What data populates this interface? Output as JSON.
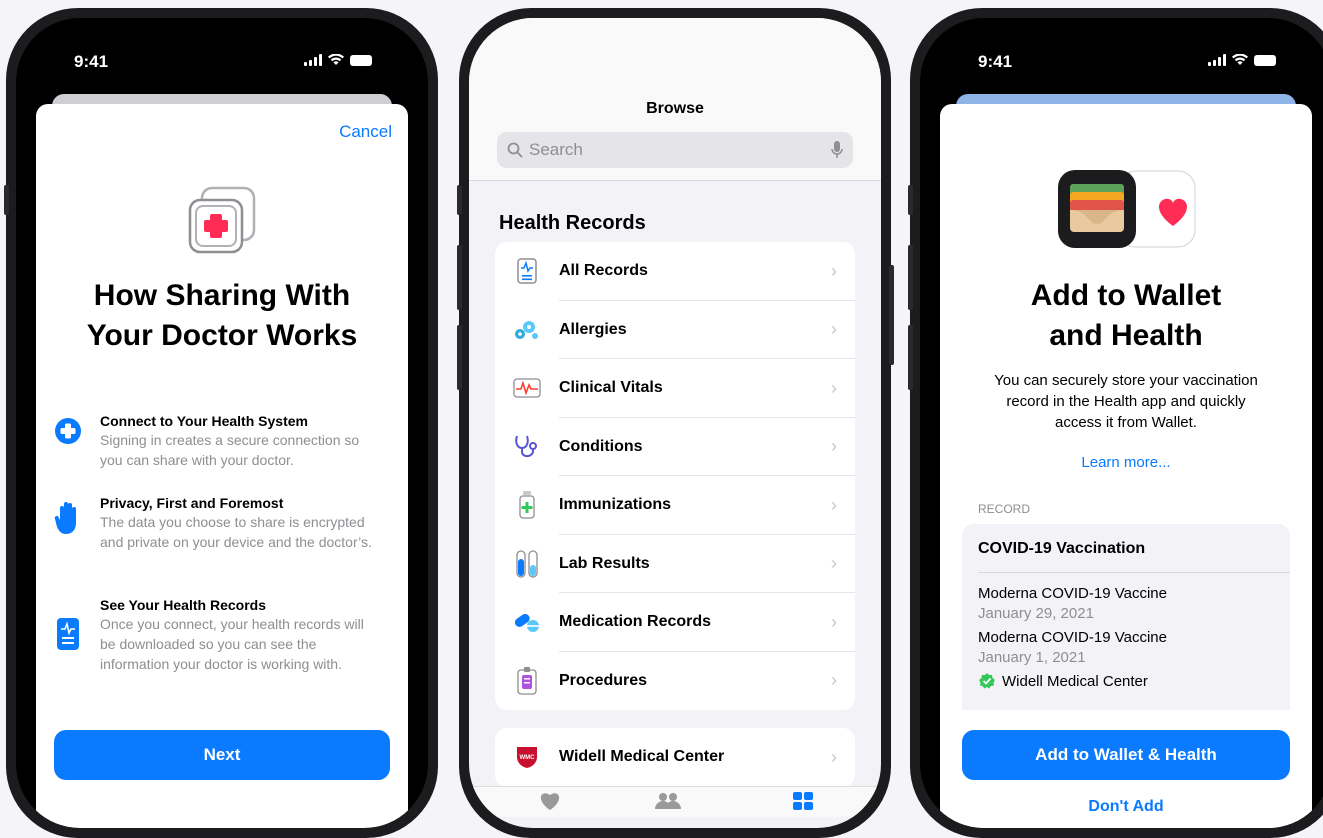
{
  "status": {
    "time": "9:41"
  },
  "left": {
    "cancel": "Cancel",
    "title_line1": "How Sharing With",
    "title_line2": "Your Doctor Works",
    "features": [
      {
        "title": "Connect to Your Health System",
        "desc": "Signing in creates a secure connection so you can share with your doctor.",
        "icon": "plus-circle-icon"
      },
      {
        "title": "Privacy, First and Foremost",
        "desc": "The data you choose to share is encrypted and private on your device and the doctor’s.",
        "icon": "hand-icon"
      },
      {
        "title": "See Your Health Records",
        "desc": "Once you connect, your health records will be downloaded so you can see the information your doctor is working with.",
        "icon": "record-icon"
      }
    ],
    "next": "Next"
  },
  "middle": {
    "nav_title": "Browse",
    "search_placeholder": "Search",
    "section": "Health Records",
    "items": [
      {
        "label": "All Records",
        "icon": "all-records-icon"
      },
      {
        "label": "Allergies",
        "icon": "allergies-icon"
      },
      {
        "label": "Clinical Vitals",
        "icon": "clinical-vitals-icon"
      },
      {
        "label": "Conditions",
        "icon": "stethoscope-icon"
      },
      {
        "label": "Immunizations",
        "icon": "vial-icon"
      },
      {
        "label": "Lab Results",
        "icon": "test-tubes-icon"
      },
      {
        "label": "Medication Records",
        "icon": "pills-icon"
      },
      {
        "label": "Procedures",
        "icon": "procedures-icon"
      }
    ],
    "provider": "Widell Medical Center",
    "provider_icon_text": "WMC"
  },
  "right": {
    "title_line1": "Add to Wallet",
    "title_line2": "and Health",
    "desc": "You can securely store your vaccination record in the Health app and quickly access it from Wallet.",
    "learn_more": "Learn more...",
    "record_label": "RECORD",
    "record_title": "COVID-19 Vaccination",
    "doses": [
      {
        "name": "Moderna COVID-19 Vaccine",
        "date": "January 29, 2021"
      },
      {
        "name": "Moderna COVID-19 Vaccine",
        "date": "January 1, 2021"
      }
    ],
    "issuer": "Widell Medical Center",
    "add_button": "Add to Wallet & Health",
    "dont_add": "Don't Add"
  },
  "colors": {
    "accent": "#0a7aff",
    "health_red": "#ff2d55",
    "verified_green": "#34c759"
  }
}
